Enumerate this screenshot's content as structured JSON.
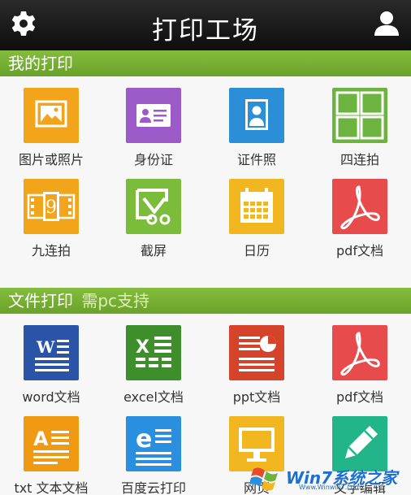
{
  "header": {
    "title": "打印工场"
  },
  "sections": [
    {
      "title": "我的打印",
      "note": "",
      "items": [
        {
          "label": "图片或照片",
          "icon": "image-icon",
          "color": "#f2a51b"
        },
        {
          "label": "身份证",
          "icon": "id-card-icon",
          "color": "#9d5bc9"
        },
        {
          "label": "证件照",
          "icon": "portrait-icon",
          "color": "#2b8fd8"
        },
        {
          "label": "四连拍",
          "icon": "four-grid-icon",
          "color": "#6db33f"
        },
        {
          "label": "九连拍",
          "icon": "film-nine-icon",
          "color": "#f2a51b"
        },
        {
          "label": "截屏",
          "icon": "screenshot-scissors-icon",
          "color": "#7cbc3b"
        },
        {
          "label": "日历",
          "icon": "calendar-icon",
          "color": "#f2b620"
        },
        {
          "label": "pdf文档",
          "icon": "pdf-icon",
          "color": "#e84b4b"
        }
      ]
    },
    {
      "title": "文件打印",
      "note": "需pc支持",
      "items": [
        {
          "label": "word文档",
          "icon": "word-icon",
          "color": "#2a54a8"
        },
        {
          "label": "excel文档",
          "icon": "excel-icon",
          "color": "#3e8f2b"
        },
        {
          "label": "ppt文档",
          "icon": "ppt-icon",
          "color": "#d5432a"
        },
        {
          "label": "pdf文档",
          "icon": "pdf-icon",
          "color": "#e84b4b"
        },
        {
          "label": "txt 文本文档",
          "icon": "text-doc-icon",
          "color": "#f09a14"
        },
        {
          "label": "百度云打印",
          "icon": "baidu-cloud-icon",
          "color": "#2b8fe0"
        },
        {
          "label": "网页",
          "icon": "monitor-icon",
          "color": "#f2b620"
        },
        {
          "label": "文字编辑",
          "icon": "pencil-edit-icon",
          "color": "#22b58a"
        }
      ]
    }
  ],
  "watermark": {
    "text": "Win7系统之家",
    "sub": "Www.Winwin7.com"
  }
}
